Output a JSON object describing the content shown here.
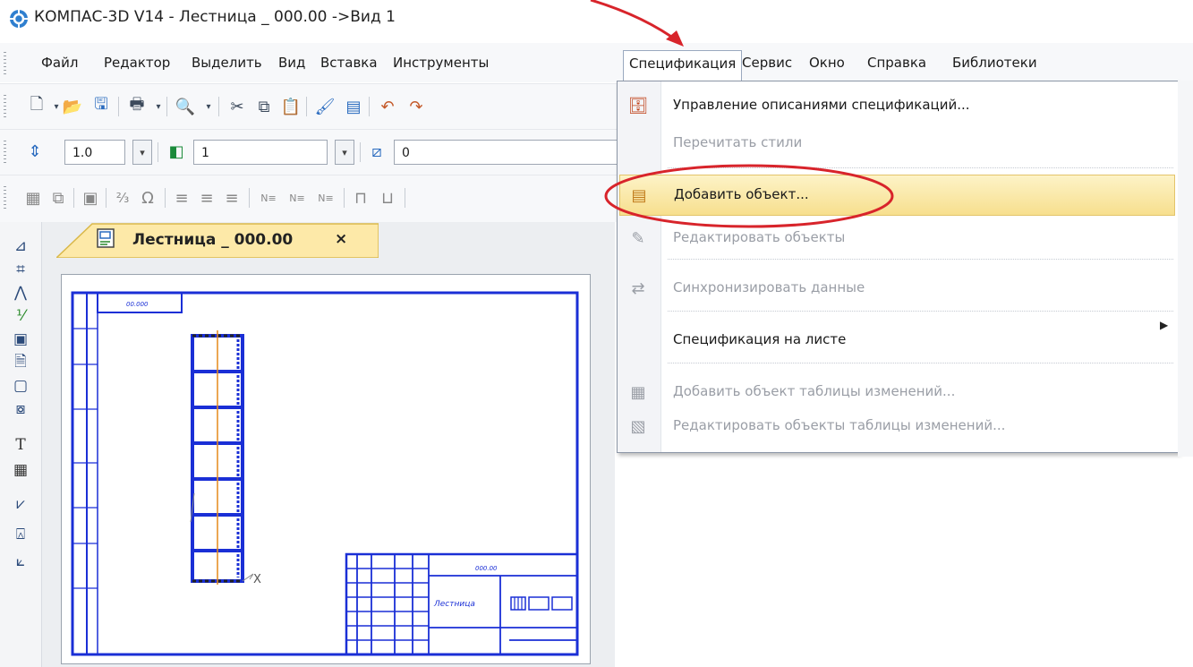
{
  "window": {
    "title": "КОМПАС-3D V14 - Лестница _ 000.00 ->Вид 1"
  },
  "menubar": {
    "items": [
      {
        "label": "Файл"
      },
      {
        "label": "Редактор"
      },
      {
        "label": "Выделить"
      },
      {
        "label": "Вид"
      },
      {
        "label": "Вставка"
      },
      {
        "label": "Инструменты"
      },
      {
        "label": "Спецификация"
      },
      {
        "label": "Сервис"
      },
      {
        "label": "Окно"
      },
      {
        "label": "Справка"
      },
      {
        "label": "Библиотеки"
      }
    ],
    "active": "Спецификация"
  },
  "toolbar2": {
    "scale_value": "1.0",
    "layer_value": "1",
    "style_value": "0"
  },
  "toolbar3": {
    "numbering_labels": [
      "N≡",
      "N≡",
      "N≡"
    ]
  },
  "document_tab": {
    "label": "Лестница _ 000.00",
    "close": "×"
  },
  "drawing": {
    "stamp_code_top": "00.000",
    "stamp_designation": "000.00",
    "stamp_name": "Лестница",
    "axis_label": "X"
  },
  "dropdown": {
    "items": [
      {
        "label": "Управление описаниями спецификаций...",
        "enabled": true,
        "icon": "spec-styles-icon"
      },
      {
        "label": "Перечитать стили",
        "enabled": false,
        "icon": ""
      },
      {
        "label": "Добавить объект...",
        "enabled": true,
        "icon": "add-object-icon",
        "highlighted": true
      },
      {
        "label": "Редактировать объекты",
        "enabled": false,
        "icon": "edit-objects-icon"
      },
      {
        "label": "Синхронизировать данные",
        "enabled": false,
        "icon": "sync-data-icon"
      },
      {
        "label": "Спецификация на листе",
        "enabled": true,
        "icon": "",
        "submenu": true
      },
      {
        "label": "Добавить объект таблицы изменений...",
        "enabled": false,
        "icon": "add-change-table-icon"
      },
      {
        "label": "Редактировать объекты таблицы изменений...",
        "enabled": false,
        "icon": "edit-change-table-icon"
      }
    ]
  },
  "colors": {
    "annotation_red": "#d8242b",
    "drawing_blue": "#1a2fd6",
    "highlight": "#f7df8e",
    "disabled_text": "#9a9ea6"
  }
}
